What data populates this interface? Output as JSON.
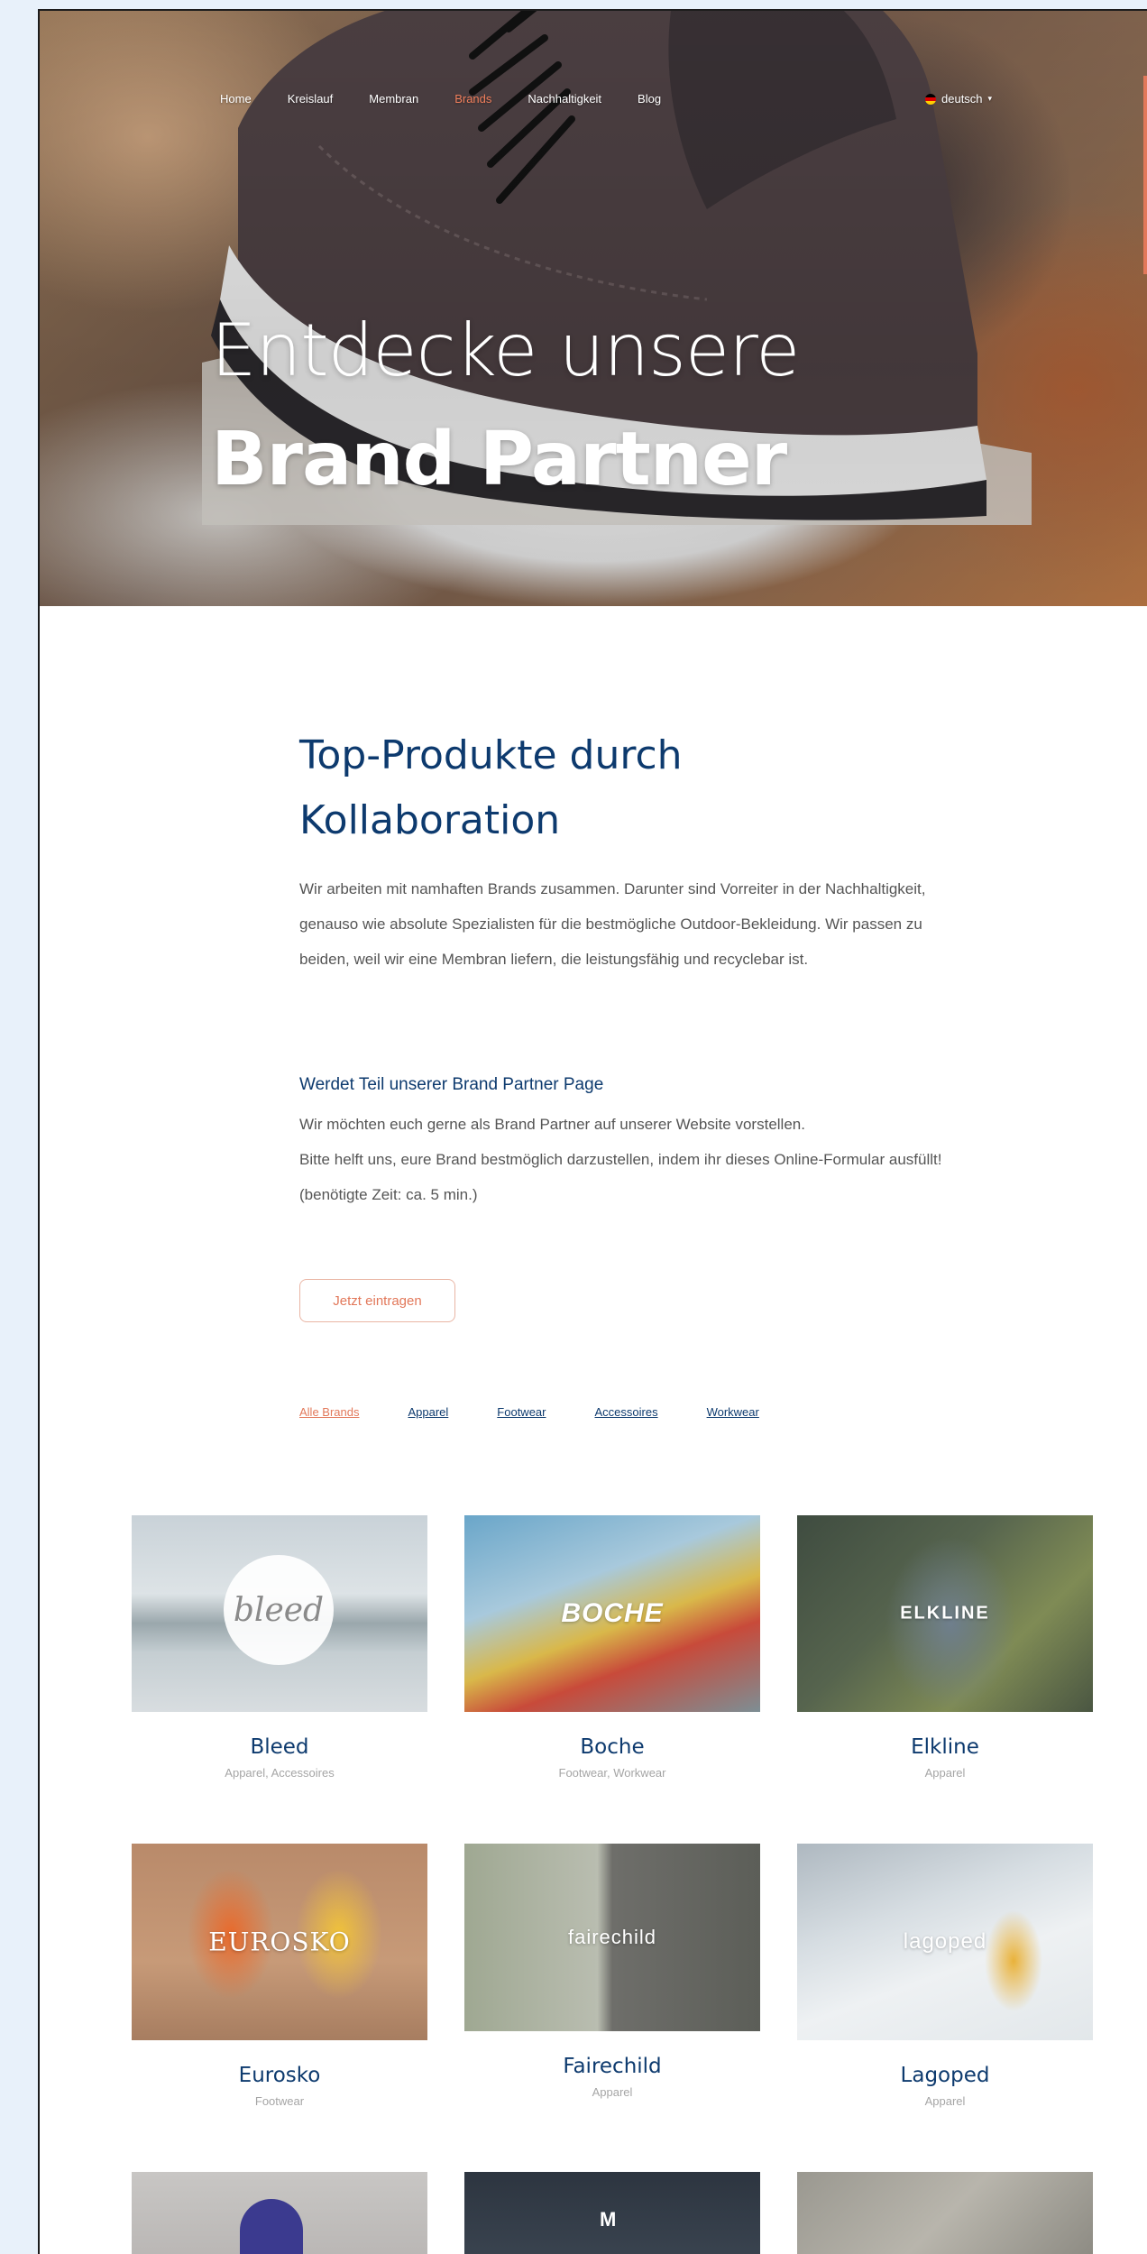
{
  "nav": {
    "items": [
      "Home",
      "Kreislauf",
      "Membran",
      "Brands",
      "Nachhaltigkeit",
      "Blog"
    ],
    "active_index": 3,
    "language": "deutsch"
  },
  "hero": {
    "title_light": "Entdecke unsere",
    "title_bold": "Brand Partner"
  },
  "intro": {
    "title_line1": "Top-Produkte durch",
    "title_line2": "Kollaboration",
    "text": "Wir arbeiten mit namhaften Brands zusammen. Darunter sind Vorreiter in der Nachhaltigkeit, genauso wie absolute Spezialisten für die bestmögliche Outdoor-Bekleidung. Wir passen zu beiden, weil wir eine Membran liefern, die leistungsfähig und recyclebar ist."
  },
  "partner": {
    "title": "Werdet Teil unserer Brand Partner Page",
    "text_line1": "Wir möchten euch gerne als Brand Partner auf unserer Website vorstellen.",
    "text_line2": "Bitte helft uns, eure Brand bestmöglich darzustellen, indem ihr dieses Online-Formular ausfüllt!",
    "text_line3": "(benötigte Zeit: ca. 5 min.)",
    "cta_label": "Jetzt eintragen"
  },
  "filters": {
    "items": [
      "Alle Brands",
      "Apparel",
      "Footwear",
      "Accessoires",
      "Workwear"
    ],
    "active_index": 0
  },
  "brands": [
    {
      "name": "Bleed",
      "categories": "Apparel, Accessoires",
      "logo_text": "bleed"
    },
    {
      "name": "Boche",
      "categories": "Footwear, Workwear",
      "logo_text": "BOCHE"
    },
    {
      "name": "Elkline",
      "categories": "Apparel",
      "logo_text": "ELKLINE"
    },
    {
      "name": "Eurosko",
      "categories": "Footwear",
      "logo_text": "EUROSKO"
    },
    {
      "name": "Fairechild",
      "categories": "Apparel",
      "logo_text": "fairechild"
    },
    {
      "name": "Lagoped",
      "categories": "Apparel",
      "logo_text": "lagoped"
    }
  ],
  "colors": {
    "primary": "#0d3a6e",
    "accent": "#e2785a",
    "muted_text": "#a5a5a5"
  }
}
